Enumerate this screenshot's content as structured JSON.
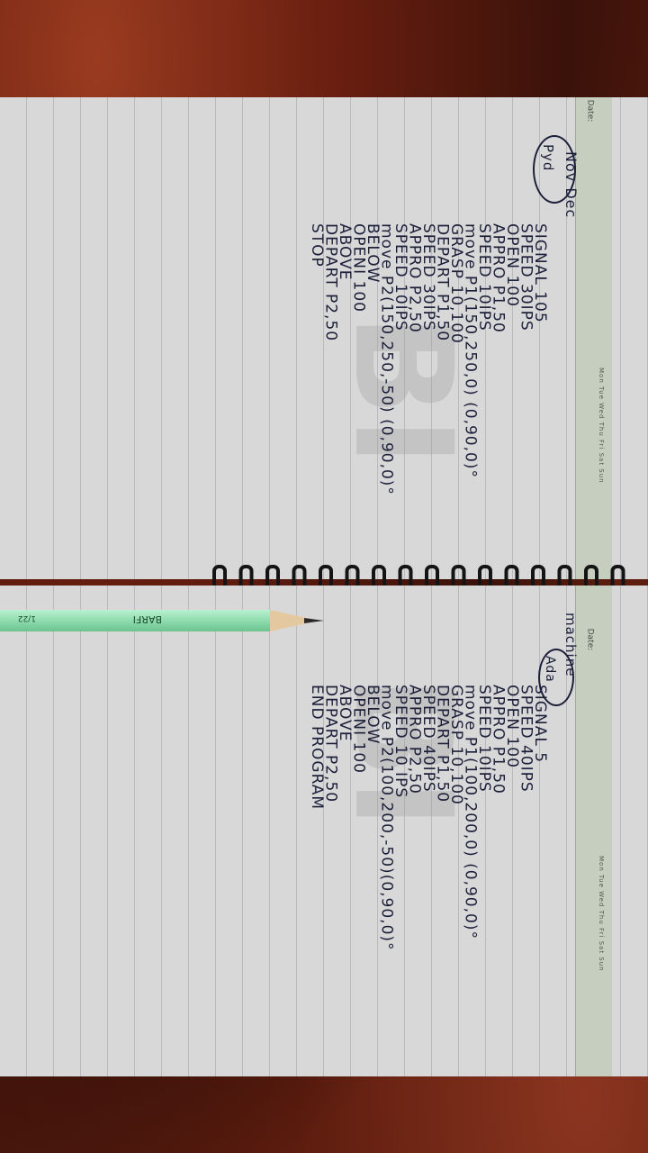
{
  "top_page": {
    "date_label": "Date:",
    "day_row": "Mon Tue Wed Thu Fri Sat Sun",
    "title": "Nov Dec",
    "tag": "Pyd",
    "lines": [
      "SIGNAL 105",
      "SPEED 30IPS",
      "OPEN 100",
      "APPRO P1,50",
      "SPEED 10IPS",
      "move P1(150,250,0) (0,90,0)°",
      "GRASP 10,100",
      "DEPART P1,50",
      "SPEED 30IPS",
      "APPRO P2,50",
      "SPEED 10IPS",
      "move P2(150,250,-50) (0,90,0)°",
      "BELOW",
      "OPENI 100",
      "ABOVE",
      "DEPART P2,50",
      "STOP"
    ]
  },
  "bottom_page": {
    "date_label": "Date:",
    "day_row": "Mon Tue Wed Thu Fri Sat Sun",
    "title": "machine",
    "tag": "Ada",
    "lines": [
      "SIGNAL 5",
      "SPEED 40IPS",
      "OPEN 100",
      "APPRO P1,50",
      "SPEED 10IPS",
      "move P1(100,200,0) (0,90,0)°",
      "GRASP 10,100",
      "DEPART P1,50",
      "SPEED 40IPS",
      "APPRO P2,50",
      "SPEED 10 IPS",
      "move P2(100,200,-50)(0,90,0)°",
      "BELOW",
      "OPENI 100",
      "ABOVE",
      "DEPART P2,50",
      "END PROGRAM"
    ]
  },
  "pencil": {
    "brand": "BARFI",
    "code": "1/22"
  },
  "watermark": "BI"
}
